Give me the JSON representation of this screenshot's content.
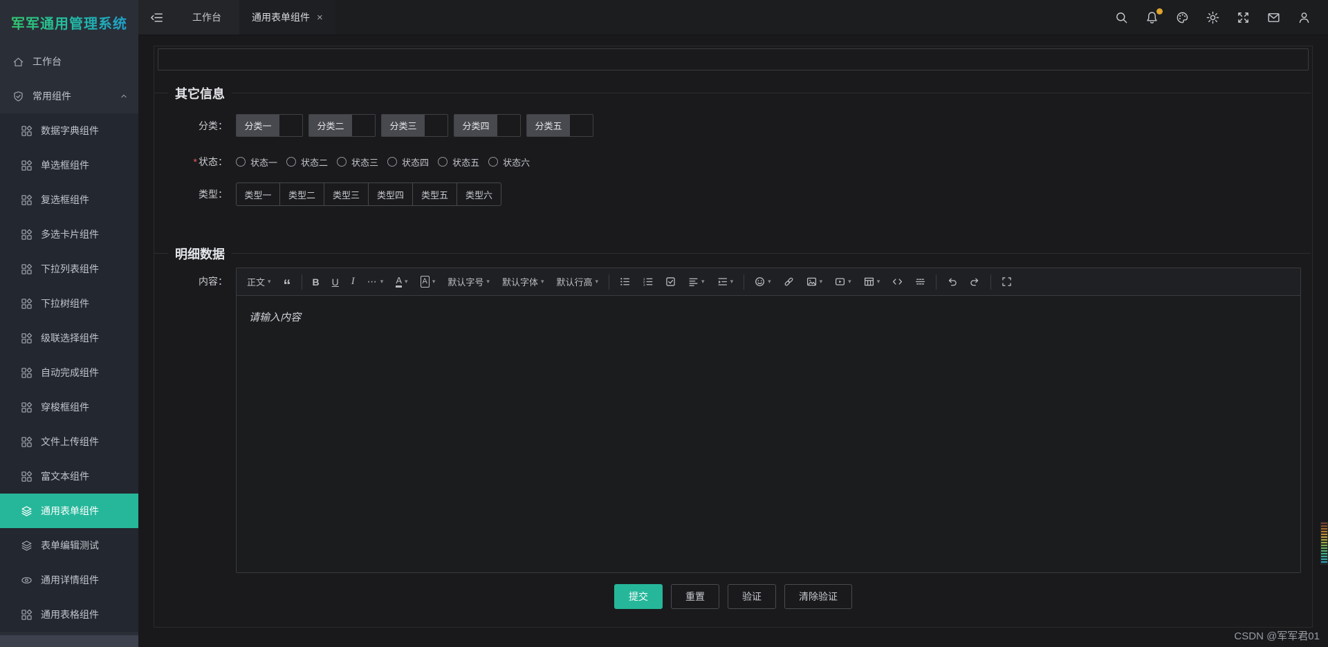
{
  "app": {
    "title": "军军通用管理系统"
  },
  "topbar": {
    "close_glyph": "×",
    "tabs": [
      {
        "label": "工作台",
        "active": false,
        "closable": false
      },
      {
        "label": "通用表单组件",
        "active": true,
        "closable": true
      }
    ],
    "actions": [
      {
        "name": "search",
        "icon": "search-icon"
      },
      {
        "name": "notifications",
        "icon": "bell-icon",
        "badge": true
      },
      {
        "name": "theme-palette",
        "icon": "palette-icon"
      },
      {
        "name": "light-mode",
        "icon": "sun-icon"
      },
      {
        "name": "fullscreen-toggle",
        "icon": "expand-icon"
      },
      {
        "name": "messages",
        "icon": "mail-icon"
      },
      {
        "name": "user-profile",
        "icon": "user-icon"
      }
    ],
    "badge_color": "#e0a32e"
  },
  "sidebar": {
    "items": [
      {
        "label": "工作台",
        "icon": "home-icon",
        "level": "root"
      },
      {
        "label": "常用组件",
        "icon": "shield-check-icon",
        "level": "root",
        "expanded": true
      },
      {
        "label": "数据字典组件",
        "icon": "component-icon",
        "level": "sub"
      },
      {
        "label": "单选框组件",
        "icon": "component-icon",
        "level": "sub"
      },
      {
        "label": "复选框组件",
        "icon": "component-icon",
        "level": "sub"
      },
      {
        "label": "多选卡片组件",
        "icon": "component-icon",
        "level": "sub"
      },
      {
        "label": "下拉列表组件",
        "icon": "component-icon",
        "level": "sub"
      },
      {
        "label": "下拉树组件",
        "icon": "component-icon",
        "level": "sub"
      },
      {
        "label": "级联选择组件",
        "icon": "component-icon",
        "level": "sub"
      },
      {
        "label": "自动完成组件",
        "icon": "component-icon",
        "level": "sub"
      },
      {
        "label": "穿梭框组件",
        "icon": "component-icon",
        "level": "sub"
      },
      {
        "label": "文件上传组件",
        "icon": "component-icon",
        "level": "sub"
      },
      {
        "label": "富文本组件",
        "icon": "component-icon",
        "level": "sub"
      },
      {
        "label": "通用表单组件",
        "icon": "layers-icon",
        "level": "sub",
        "active": true
      },
      {
        "label": "表单编辑测试",
        "icon": "layers-icon",
        "level": "sub"
      },
      {
        "label": "通用详情组件",
        "icon": "eye-icon",
        "level": "sub"
      },
      {
        "label": "通用表格组件",
        "icon": "component-icon",
        "level": "sub"
      }
    ]
  },
  "form": {
    "other": {
      "title": "其它信息",
      "category": {
        "label": "分类：",
        "options": [
          "分类一",
          "分类二",
          "分类三",
          "分类四",
          "分类五"
        ]
      },
      "status": {
        "label": "状态：",
        "required_mark": "*",
        "options": [
          "状态一",
          "状态二",
          "状态三",
          "状态四",
          "状态五",
          "状态六"
        ]
      },
      "type": {
        "label": "类型：",
        "options": [
          "类型一",
          "类型二",
          "类型三",
          "类型四",
          "类型五",
          "类型六"
        ]
      }
    },
    "detail": {
      "title": "明细数据",
      "content_label": "内容：",
      "editor": {
        "placeholder": "请输入内容",
        "caret_glyph": "▾",
        "toolbar": [
          {
            "name": "heading-select",
            "label": "正文",
            "caret": true
          },
          {
            "name": "blockquote-button",
            "glyph": "“",
            "variant": "quote"
          },
          {
            "name": "separator"
          },
          {
            "name": "bold-button",
            "glyph": "B",
            "variant": "bold"
          },
          {
            "name": "underline-button",
            "glyph": "U",
            "variant": "underline"
          },
          {
            "name": "italic-button",
            "glyph": "I",
            "variant": "italic"
          },
          {
            "name": "more-style-button",
            "glyph": "⋯",
            "variant": "more",
            "caret": true
          },
          {
            "name": "font-color-button",
            "glyph": "A",
            "variant": "underbar",
            "caret": true
          },
          {
            "name": "bg-color-button",
            "glyph": "A",
            "variant": "boxed",
            "caret": true
          },
          {
            "name": "font-size-select",
            "label": "默认字号",
            "caret": true
          },
          {
            "name": "font-family-select",
            "label": "默认字体",
            "caret": true
          },
          {
            "name": "line-height-select",
            "label": "默认行高",
            "caret": true
          },
          {
            "name": "separator"
          },
          {
            "name": "bullet-list-button",
            "icon": "ul-icon"
          },
          {
            "name": "ordered-list-button",
            "icon": "ol-icon"
          },
          {
            "name": "todo-list-button",
            "icon": "todo-icon"
          },
          {
            "name": "align-button",
            "icon": "align-icon",
            "caret": true
          },
          {
            "name": "indent-button",
            "icon": "indent-icon",
            "caret": true
          },
          {
            "name": "separator"
          },
          {
            "name": "emoji-button",
            "icon": "emoji-icon",
            "caret": true
          },
          {
            "name": "link-button",
            "icon": "link-icon"
          },
          {
            "name": "image-button",
            "icon": "image-icon",
            "caret": true
          },
          {
            "name": "video-button",
            "icon": "video-icon",
            "caret": true
          },
          {
            "name": "table-button",
            "icon": "table-icon",
            "caret": true
          },
          {
            "name": "code-button",
            "icon": "code-icon"
          },
          {
            "name": "hr-button",
            "icon": "hr-icon"
          },
          {
            "name": "separator"
          },
          {
            "name": "undo-button",
            "icon": "undo-icon"
          },
          {
            "name": "redo-button",
            "icon": "redo-icon"
          },
          {
            "name": "separator"
          },
          {
            "name": "fullscreen-button",
            "icon": "fullscreen-icon"
          }
        ]
      }
    },
    "actions": [
      {
        "name": "submit",
        "label": "提交",
        "variant": "primary"
      },
      {
        "name": "reset",
        "label": "重置",
        "variant": "ghost"
      },
      {
        "name": "validate",
        "label": "验证",
        "variant": "ghost"
      },
      {
        "name": "clear-validation",
        "label": "清除验证",
        "variant": "ghost"
      }
    ]
  },
  "watermark": "CSDN @军军君01",
  "colors": {
    "accent": "#26b79a",
    "badge": "#e0a32e",
    "required": "#f25a5a"
  }
}
